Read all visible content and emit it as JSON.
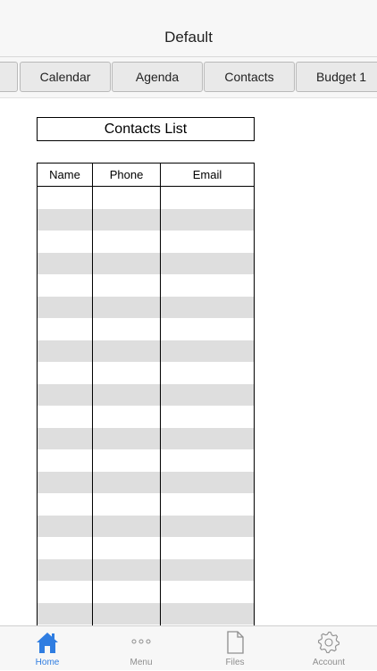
{
  "nav": {
    "title": "Default"
  },
  "tabs": [
    {
      "label": ""
    },
    {
      "label": "Calendar"
    },
    {
      "label": "Agenda"
    },
    {
      "label": "Contacts"
    },
    {
      "label": "Budget 1"
    }
  ],
  "contacts": {
    "title": "Contacts List",
    "columns": [
      "Name",
      "Phone",
      "Email"
    ],
    "row_count": 20
  },
  "tab_bar": {
    "items": [
      {
        "label": "Home",
        "icon": "home-icon",
        "active": true
      },
      {
        "label": "Menu",
        "icon": "more-dots-icon",
        "active": false
      },
      {
        "label": "Files",
        "icon": "file-icon",
        "active": false
      },
      {
        "label": "Account",
        "icon": "gear-icon",
        "active": false
      }
    ]
  },
  "colors": {
    "accent": "#2f7de1",
    "inactive": "#8e8e8e",
    "row_shade": "#dedede"
  }
}
